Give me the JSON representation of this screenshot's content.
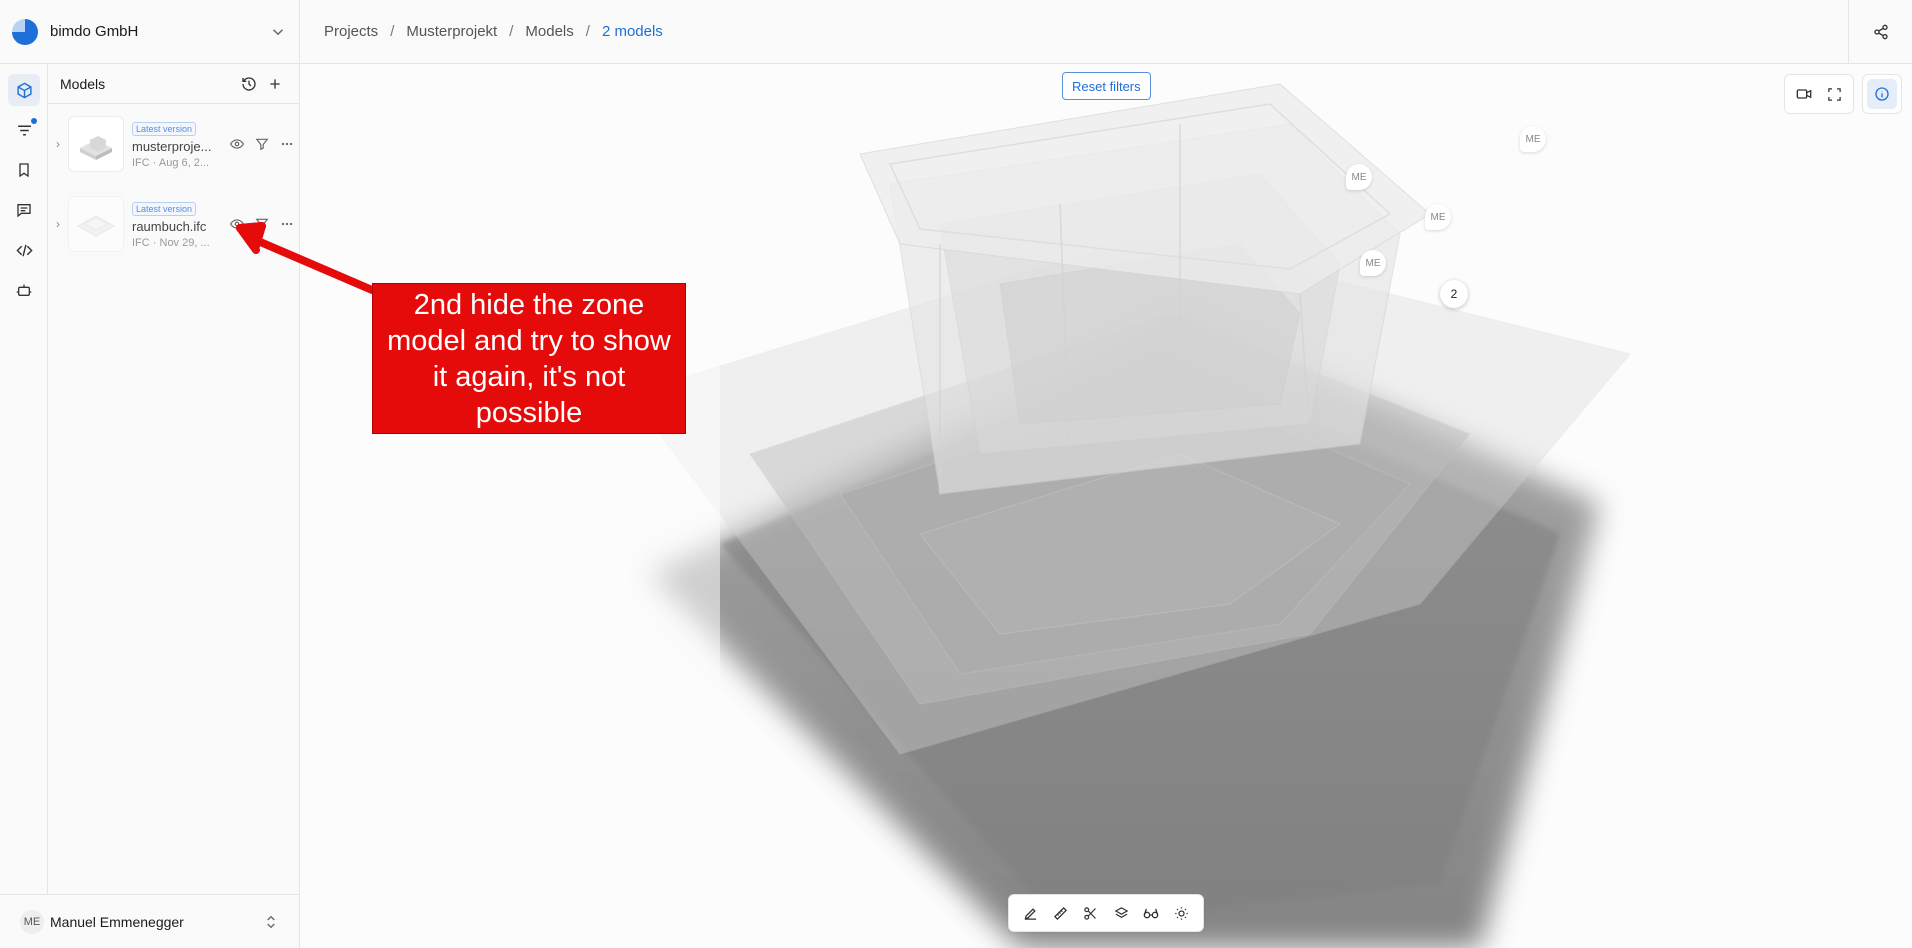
{
  "org": {
    "name": "bimdo GmbH"
  },
  "breadcrumb": [
    {
      "label": "Projects"
    },
    {
      "label": "Musterprojekt"
    },
    {
      "label": "Models"
    },
    {
      "label": "2 models"
    }
  ],
  "breadcrumb_separator": "/",
  "panel": {
    "title": "Models",
    "models": [
      {
        "badge": "Latest version",
        "name": "musterproje...",
        "meta": "IFC · Aug 6, 2..."
      },
      {
        "badge": "Latest version",
        "name": "raumbuch.ifc",
        "meta": "IFC · Nov 29, ..."
      }
    ]
  },
  "viewer": {
    "reset_filters": "Reset filters",
    "markers": [
      "ME",
      "ME",
      "ME",
      "ME"
    ],
    "cluster_count": "2"
  },
  "user": {
    "initials": "ME",
    "name": "Manuel Emmenegger"
  },
  "annotation": {
    "text": "2nd hide the zone model and try to show it again, it's not possible"
  },
  "colors": {
    "accent": "#1f6fd8",
    "annotation": "#e50b0b"
  }
}
